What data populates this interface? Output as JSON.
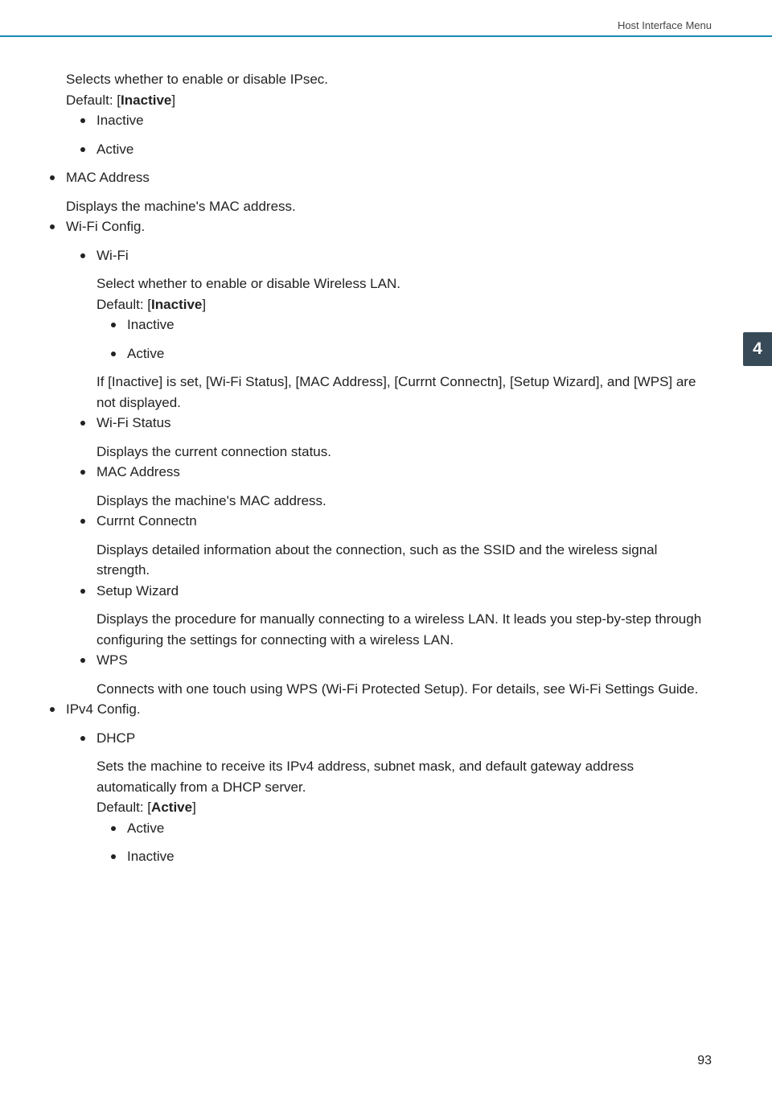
{
  "header": {
    "section": "Host Interface Menu"
  },
  "tab": {
    "number": "4"
  },
  "page": {
    "number": "93"
  },
  "t": {
    "ipsec_desc": "Selects whether to enable or disable IPsec.",
    "default_prefix": "Default: [",
    "default_suffix": "]",
    "inactive_bold": "Inactive",
    "active_bold": "Active",
    "opt_inactive": "Inactive",
    "opt_active": "Active",
    "mac_address": "MAC Address",
    "mac_desc": "Displays the machine's MAC address.",
    "wifi_config": "Wi-Fi Config.",
    "wifi": "Wi-Fi",
    "wifi_desc": "Select whether to enable or disable Wireless LAN.",
    "wifi_note": "If [Inactive] is set, [Wi-Fi Status], [MAC Address], [Currnt Connectn], [Setup Wizard], and [WPS] are not displayed.",
    "wifi_status": "Wi-Fi Status",
    "wifi_status_desc": "Displays the current connection status.",
    "mac2_desc": "Displays the machine's MAC address.",
    "currnt": "Currnt Connectn",
    "currnt_desc": "Displays detailed information about the connection, such as the SSID and the wireless signal strength.",
    "setup_wizard": "Setup Wizard",
    "setup_desc": "Displays the procedure for manually connecting to a wireless LAN. It leads you step-by-step through configuring the settings for connecting with a wireless LAN.",
    "wps": "WPS",
    "wps_desc": "Connects with one touch using WPS (Wi-Fi Protected Setup). For details, see Wi-Fi Settings Guide.",
    "ipv4": "IPv4 Config.",
    "dhcp": "DHCP",
    "dhcp_desc": "Sets the machine to receive its IPv4 address, subnet mask, and default gateway address automatically from a DHCP server."
  }
}
